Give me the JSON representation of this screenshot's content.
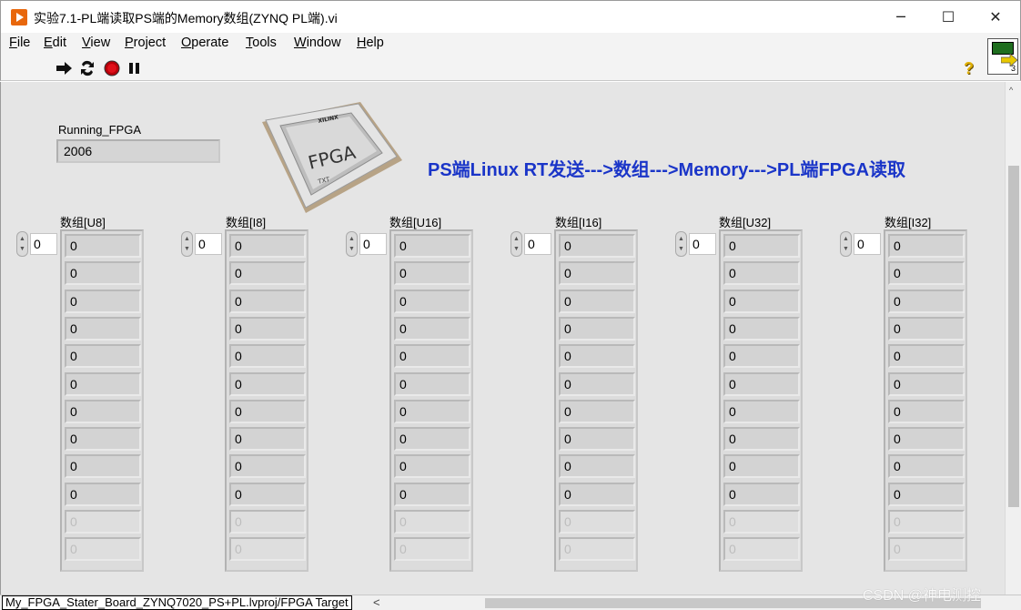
{
  "window": {
    "title": "实验7.1-PL端读取PS端的Memory数组(ZYNQ PL端).vi",
    "minimize": "─",
    "maximize": "☐",
    "close": "✕"
  },
  "menu": [
    {
      "label": "File",
      "u": "F",
      "rest": "ile"
    },
    {
      "label": "Edit",
      "u": "E",
      "rest": "dit"
    },
    {
      "label": "View",
      "u": "V",
      "rest": "iew"
    },
    {
      "label": "Project",
      "u": "P",
      "rest": "roject"
    },
    {
      "label": "Operate",
      "u": "O",
      "rest": "perate"
    },
    {
      "label": "Tools",
      "u": "T",
      "rest": "ools"
    },
    {
      "label": "Window",
      "u": "W",
      "rest": "indow"
    },
    {
      "label": "Help",
      "u": "H",
      "rest": "elp"
    }
  ],
  "toolbar": {
    "help": "?",
    "vi_icon_number": "3"
  },
  "panel": {
    "running_label": "Running_FPGA",
    "running_value": "2006",
    "chip_text": "FPGA",
    "chip_brand": "XILINX",
    "chip_sub": "TXT",
    "banner": "PS端Linux RT发送--->数组--->Memory--->PL端FPGA读取"
  },
  "arrays": [
    {
      "label": "数组[U8]",
      "index": "0",
      "values": [
        "0",
        "0",
        "0",
        "0",
        "0",
        "0",
        "0",
        "0",
        "0",
        "0",
        "0",
        "0"
      ]
    },
    {
      "label": "数组[I8]",
      "index": "0",
      "values": [
        "0",
        "0",
        "0",
        "0",
        "0",
        "0",
        "0",
        "0",
        "0",
        "0",
        "0",
        "0"
      ]
    },
    {
      "label": "数组[U16]",
      "index": "0",
      "values": [
        "0",
        "0",
        "0",
        "0",
        "0",
        "0",
        "0",
        "0",
        "0",
        "0",
        "0",
        "0"
      ]
    },
    {
      "label": "数组[I16]",
      "index": "0",
      "values": [
        "0",
        "0",
        "0",
        "0",
        "0",
        "0",
        "0",
        "0",
        "0",
        "0",
        "0",
        "0"
      ]
    },
    {
      "label": "数组[U32]",
      "index": "0",
      "values": [
        "0",
        "0",
        "0",
        "0",
        "0",
        "0",
        "0",
        "0",
        "0",
        "0",
        "0",
        "0"
      ]
    },
    {
      "label": "数组[I32]",
      "index": "0",
      "values": [
        "0",
        "0",
        "0",
        "0",
        "0",
        "0",
        "0",
        "0",
        "0",
        "0",
        "0",
        "0"
      ]
    }
  ],
  "array_enabled_count": 10,
  "status": {
    "path": "My_FPGA_Stater_Board_ZYNQ7020_PS+PL.lvproj/FPGA Target"
  },
  "watermark": "CSDN @神电测控",
  "colors": {
    "banner": "#1a35c8",
    "app_icon": "#e8670c",
    "panel_bg": "#e5e5e5"
  }
}
